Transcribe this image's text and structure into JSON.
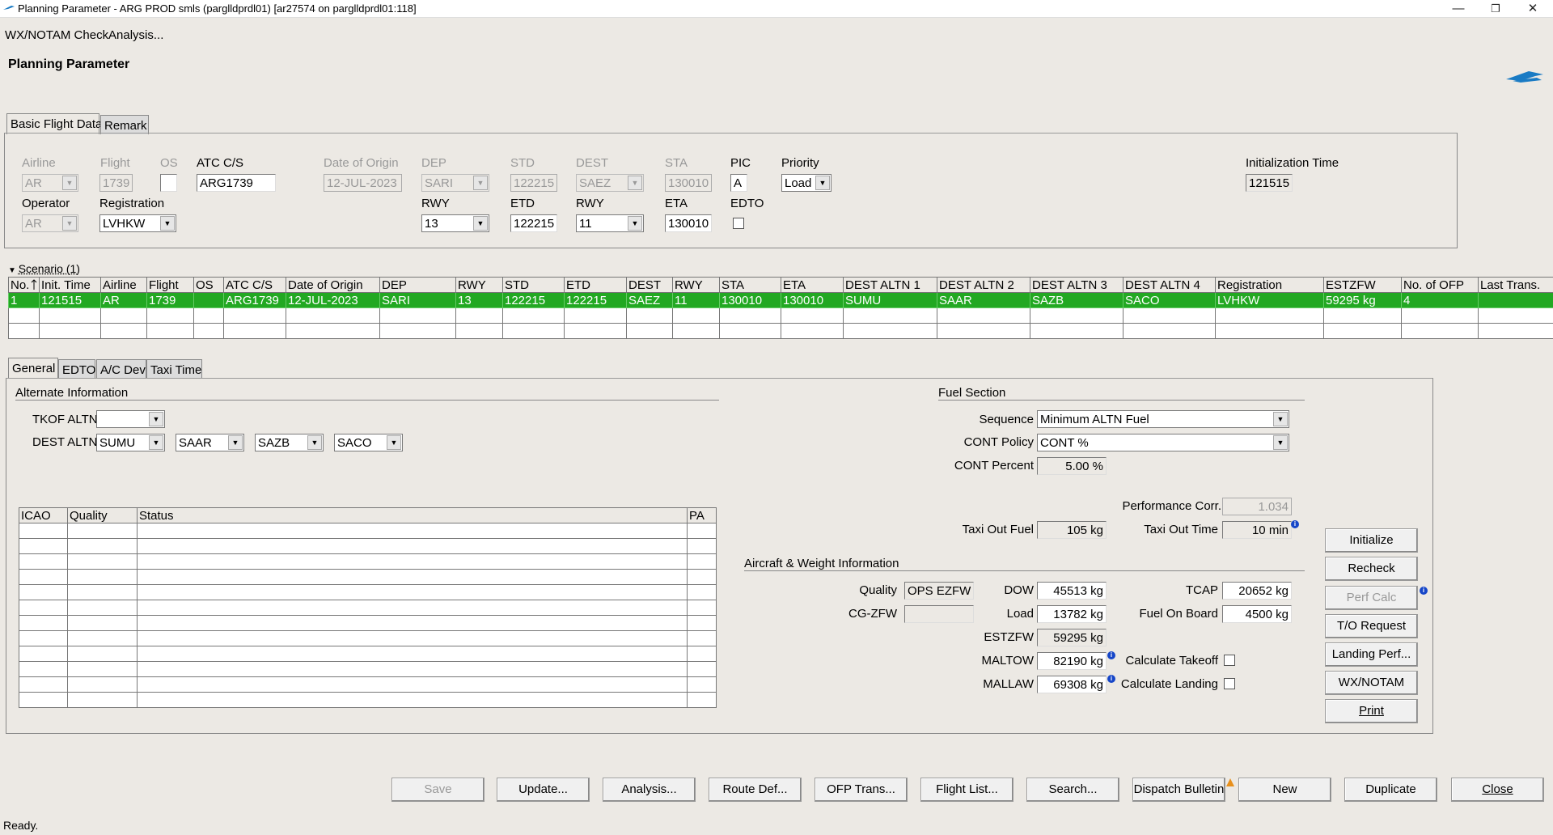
{
  "window": {
    "title": "Planning Parameter  - ARG PROD smls (parglldprdl01) [ar27574 on parglldprdl01:118]",
    "minimize": "—",
    "restore": "❐",
    "close": "✕"
  },
  "menu": {
    "wx": "WX/NOTAM Check",
    "analysis": "Analysis..."
  },
  "page_title": "Planning Parameter",
  "top_tabs": {
    "basic": "Basic Flight Data",
    "remark": "Remark"
  },
  "basic": {
    "airline_label": "Airline",
    "airline": "AR",
    "flight_label": "Flight",
    "flight": "1739",
    "os_label": "OS",
    "os": "",
    "atc_label": "ATC C/S",
    "atc": "ARG1739",
    "doo_label": "Date of Origin",
    "doo": "12-JUL-2023",
    "dep_label": "DEP",
    "dep": "SARI",
    "std_label": "STD",
    "std": "122215",
    "dest_label": "DEST",
    "dest": "SAEZ",
    "sta_label": "STA",
    "sta": "130010",
    "pic_label": "PIC",
    "pic": "A",
    "priority_label": "Priority",
    "priority": "Load",
    "init_time_label": "Initialization Time",
    "init_time": "121515",
    "operator_label": "Operator",
    "operator": "AR",
    "registration_label": "Registration",
    "registration": "LVHKW",
    "rwy_dep_label": "RWY",
    "rwy_dep": "13",
    "etd_label": "ETD",
    "etd": "122215",
    "rwy_dest_label": "RWY",
    "rwy_dest": "11",
    "eta_label": "ETA",
    "eta": "130010",
    "edto_label": "EDTO"
  },
  "scenario": {
    "header": "Scenario (1)",
    "columns": [
      "No.",
      "Init. Time",
      "Airline",
      "Flight",
      "OS",
      "ATC C/S",
      "Date of Origin",
      "DEP",
      "RWY",
      "STD",
      "ETD",
      "DEST",
      "RWY",
      "STA",
      "ETA",
      "DEST ALTN 1",
      "DEST ALTN 2",
      "DEST ALTN 3",
      "DEST ALTN 4",
      "Registration",
      "ESTZFW",
      "No. of OFP",
      "Last Trans."
    ],
    "rows": [
      [
        "1",
        "121515",
        "AR",
        "1739",
        "",
        "ARG1739",
        "12-JUL-2023",
        "SARI",
        "13",
        "122215",
        "122215",
        "SAEZ",
        "11",
        "130010",
        "130010",
        "SUMU",
        "SAAR",
        "SAZB",
        "SACO",
        "LVHKW",
        "59295 kg",
        "4",
        ""
      ]
    ]
  },
  "bottom_tabs": {
    "general": "General",
    "edto": "EDTO",
    "acdev": "A/C Dev",
    "taxi": "Taxi Time"
  },
  "alternate": {
    "title": "Alternate Information",
    "tkof_label": "TKOF ALTN",
    "tkof": "",
    "dest_label": "DEST ALTN",
    "dest1": "SUMU",
    "dest2": "SAAR",
    "dest3": "SAZB",
    "dest4": "SACO",
    "columns": [
      "ICAO",
      "Quality",
      "Status",
      "PA"
    ]
  },
  "fuel": {
    "title": "Fuel Section",
    "sequence_label": "Sequence",
    "sequence": "Minimum ALTN Fuel",
    "cont_policy_label": "CONT Policy",
    "cont_policy": "CONT %",
    "cont_percent_label": "CONT Percent",
    "cont_percent": "5.00 %",
    "perf_corr_label": "Performance Corr.",
    "perf_corr": "1.034",
    "taxi_fuel_label": "Taxi Out Fuel",
    "taxi_fuel": "105 kg",
    "taxi_time_label": "Taxi Out Time",
    "taxi_time": "10 min"
  },
  "aircraft": {
    "title": "Aircraft & Weight Information",
    "quality_label": "Quality",
    "quality": "OPS EZFW",
    "cgzfw_label": "CG-ZFW",
    "cgzfw": "",
    "dow_label": "DOW",
    "dow": "45513 kg",
    "load_label": "Load",
    "load": "13782 kg",
    "estzfw_label": "ESTZFW",
    "estzfw": "59295 kg",
    "maltow_label": "MALTOW",
    "maltow": "82190 kg",
    "mallaw_label": "MALLAW",
    "mallaw": "69308 kg",
    "tcap_label": "TCAP",
    "tcap": "20652 kg",
    "fob_label": "Fuel On Board",
    "fob": "4500 kg",
    "calc_to_label": "Calculate Takeoff",
    "calc_ld_label": "Calculate Landing"
  },
  "side_buttons": {
    "initialize": "Initialize",
    "recheck": "Recheck",
    "perf_calc": "Perf Calc",
    "to_request": "T/O Request",
    "landing_perf": "Landing Perf...",
    "wxnotam": "WX/NOTAM",
    "print": "Print"
  },
  "bottom_buttons": {
    "save": "Save",
    "update": "Update...",
    "analysis": "Analysis...",
    "route_def": "Route Def...",
    "ofp_trans": "OFP Trans...",
    "flight_list": "Flight List...",
    "search": "Search...",
    "dispatch": "Dispatch Bulletin",
    "new": "New",
    "duplicate": "Duplicate",
    "close": "Close"
  },
  "status": "Ready.",
  "colors": {
    "selection": "#22a822",
    "info": "#1646c8",
    "accent": "#1a7bc4"
  }
}
